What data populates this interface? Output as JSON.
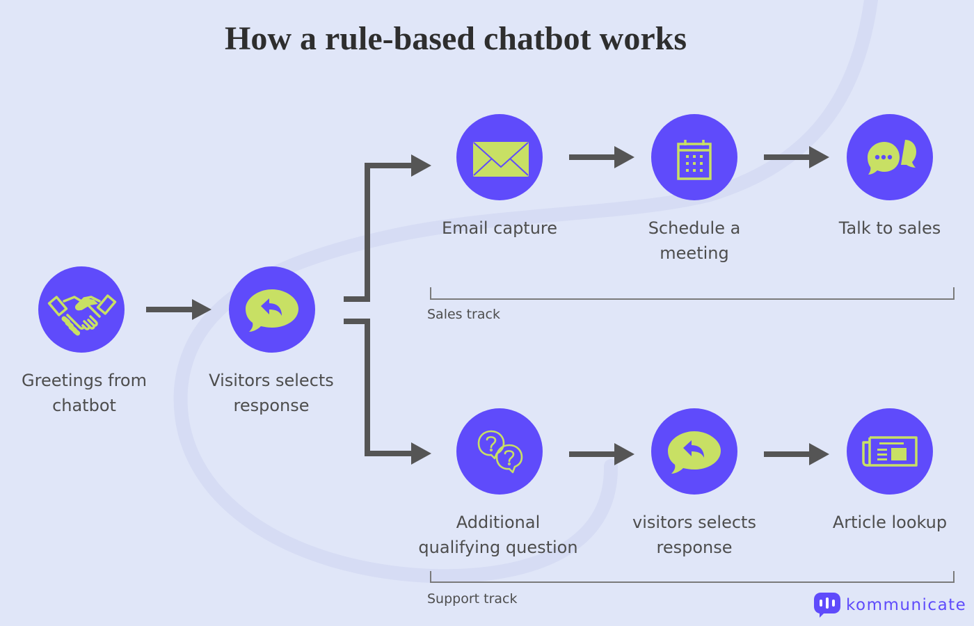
{
  "title": "How a rule-based chatbot works",
  "colors": {
    "background": "#e0e6f8",
    "swoosh": "#d6dcf4",
    "node_fill": "#5f4bfb",
    "icon_fill": "#c8e064",
    "arrow": "#555555",
    "text": "#4d4d4d",
    "title": "#2e2e2e",
    "brand": "#5f4bfb"
  },
  "steps": {
    "start": [
      {
        "icon": "handshake-icon",
        "label_lines": [
          "Greetings from",
          "chatbot"
        ]
      },
      {
        "icon": "reply-bubble-icon",
        "label_lines": [
          "Visitors selects",
          "response"
        ]
      }
    ],
    "sales": [
      {
        "icon": "envelope-icon",
        "label_lines": [
          "Email capture"
        ]
      },
      {
        "icon": "calendar-icon",
        "label_lines": [
          "Schedule a",
          "meeting"
        ]
      },
      {
        "icon": "chat-bubbles-icon",
        "label_lines": [
          "Talk to sales"
        ]
      }
    ],
    "support": [
      {
        "icon": "question-bubbles-icon",
        "label_lines": [
          "Additional",
          "qualifying question"
        ]
      },
      {
        "icon": "reply-bubble-icon",
        "label_lines": [
          "visitors selects",
          "response"
        ]
      },
      {
        "icon": "newspaper-icon",
        "label_lines": [
          "Article lookup"
        ]
      }
    ]
  },
  "tracks": {
    "sales_label": "Sales track",
    "support_label": "Support track"
  },
  "brand": {
    "name": "kommunicate"
  }
}
